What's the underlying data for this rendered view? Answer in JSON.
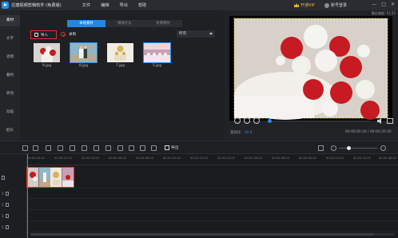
{
  "app": {
    "title": "迅捷视频剪辑软件 (免费版)",
    "menu": [
      "文件",
      "编辑",
      "导出",
      "帮助"
    ],
    "vip_label": "开通VIP",
    "account_label": "账号登录",
    "window_buttons": [
      "—",
      "□",
      "✕"
    ]
  },
  "sidebar": {
    "items": [
      "素材",
      "文字",
      "滤镜",
      "叠附",
      "转场",
      "动画",
      "配乐"
    ]
  },
  "media": {
    "tabs": [
      "本地素材",
      "精美片头",
      "背景特效"
    ],
    "active_tab": 0,
    "import_label": "导入",
    "record_label": "录制",
    "filter_value": "所有",
    "files": [
      {
        "name": "9.jpg",
        "icon": "roses-cake-thumb"
      },
      {
        "name": "8.jpg",
        "icon": "wedding-couple-thumb"
      },
      {
        "name": "7.jpg",
        "icon": "gold-cake-thumb"
      },
      {
        "name": "5.jpg",
        "icon": "banquet-hall-thumb"
      }
    ]
  },
  "preview": {
    "corner_label": "最近缩放: 12.21",
    "ratio_label": "宽高比:",
    "ratio_value": "16:9",
    "timecode": "00:00:00.00 / 00:00:20.00",
    "playback_progress": 0
  },
  "toolbar": {
    "icons": [
      "undo-icon",
      "redo-icon",
      "edit-icon",
      "split-icon",
      "delete-icon",
      "crop-icon",
      "zoom-icon",
      "mosaic-icon",
      "freeze-icon",
      "record-icon",
      "mic-icon",
      "voice-icon"
    ],
    "export_label": "导出",
    "zoom_level": 0.25
  },
  "timeline": {
    "ruler_ticks": [
      "00:00:00.00",
      "00:00:12.00",
      "00:00:24.00",
      "00:00:36.00",
      "00:00:48.00",
      "00:01:00.00",
      "00:01:12.00",
      "00:01:24.00",
      "00:01:36.00",
      "00:01:48.00",
      "00:02:00.00",
      "00:02:12.00",
      "00:02:24.00",
      "00:02:36.00"
    ],
    "track_labels": [
      "1",
      "1",
      "1",
      "1",
      "1"
    ]
  }
}
